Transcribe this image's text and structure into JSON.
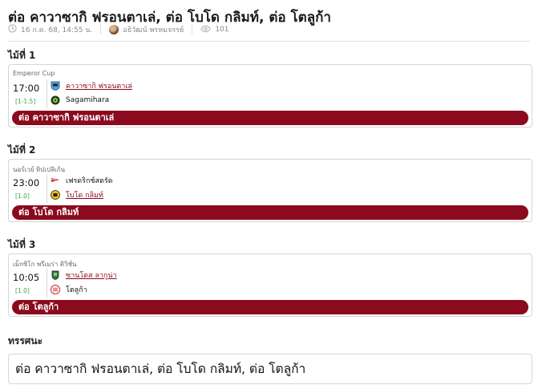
{
  "article": {
    "title": "ต่อ คาวาซากิ ฟรอนตาเล่, ต่อ โบโด กลิมท์, ต่อ โตลูก้า",
    "date": "16 ก.ค. 68, 14:55 น.",
    "author": "อธิวัฒน์ พรหมจรรย์",
    "views": "101"
  },
  "tips": [
    {
      "label": "ไม้ที่ 1",
      "league": "Emperor Cup",
      "time": "17:00",
      "handicap": "[1-1.5]",
      "home": "คาวาซากิ ฟรอนตาเล่",
      "away": "Sagamihara",
      "pick": "ต่อ คาวาซากิ ฟรอนตาเล่"
    },
    {
      "label": "ไม้ที่ 2",
      "league": "นอร์เวย์ ทิปเปลิเก้น",
      "time": "23:00",
      "handicap": "[1.0]",
      "home": "เฟรดริกช์สตรัด",
      "away": "โบโด กลิมท์",
      "pick": "ต่อ โบโด กลิมท์"
    },
    {
      "label": "ไม้ที่ 3",
      "league": "เม็กซิโก พรีเมร่า ดิวิชั่น",
      "time": "10:05",
      "handicap": "[1.0]",
      "home": "ซานโตส ลากูน่า",
      "away": "โตลูก้า",
      "pick": "ต่อ โตลูก้า"
    }
  ],
  "verdict": {
    "label": "ทรรศนะ",
    "text": "ต่อ คาวาซากิ ฟรอนตาเล่, ต่อ โบโด กลิมท์, ต่อ โตลูก้า"
  },
  "colors": {
    "accent": "#8b0a1e",
    "handicap": "#3aa547",
    "border": "#d6d6d6"
  },
  "icons": [
    "clock-icon",
    "avatar",
    "eye-icon",
    "team-crest-icon"
  ]
}
